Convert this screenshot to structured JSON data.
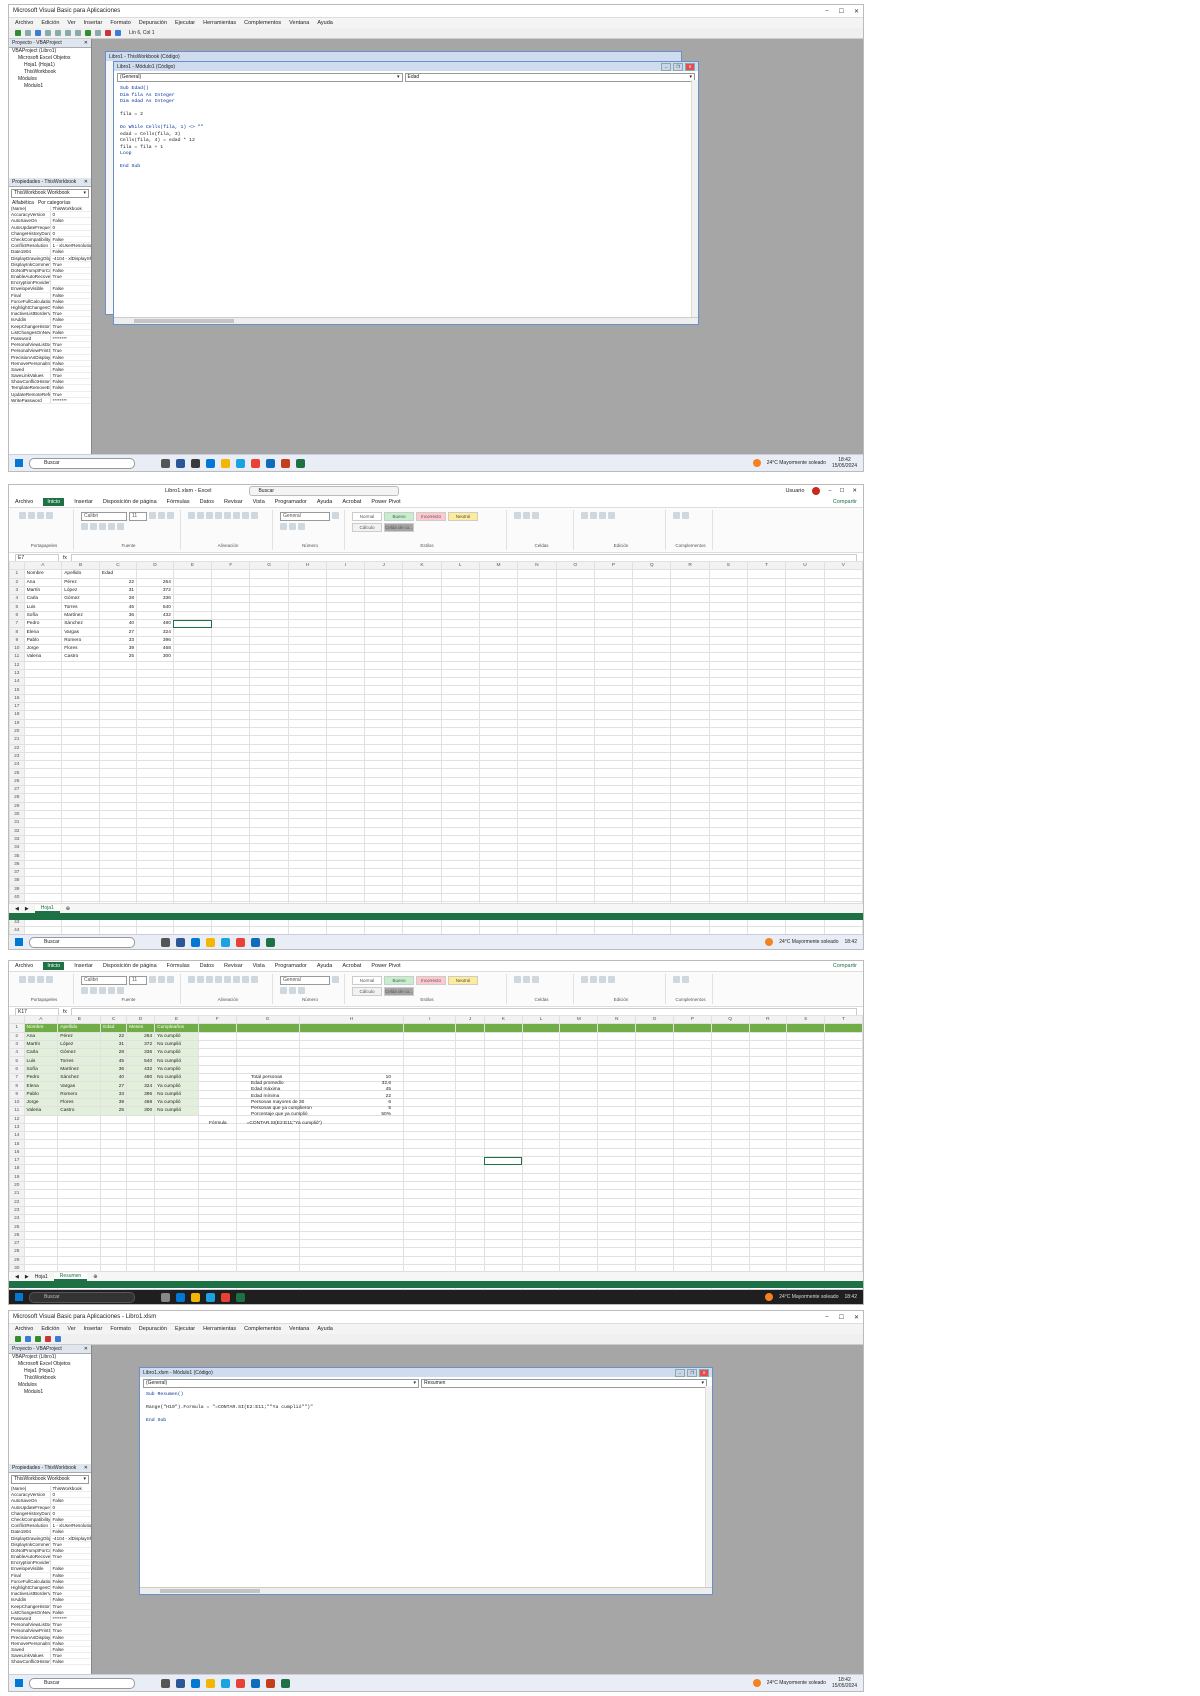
{
  "vba1": {
    "title": "Microsoft Visual Basic para Aplicaciones",
    "menu": [
      "Archivo",
      "Edición",
      "Ver",
      "Insertar",
      "Formato",
      "Depuración",
      "Ejecutar",
      "Herramientas",
      "Complementos",
      "Ventana",
      "Ayuda"
    ],
    "position": "Lín 6, Col 1",
    "project_title": "Proyecto - VBAProject",
    "tree": [
      "VBAProject (Libro1)",
      "Microsoft Excel Objetos",
      "Hoja1 (Hoja1)",
      "ThisWorkbook",
      "Módulos",
      "Módulo1"
    ],
    "props_title": "Propiedades - ThisWorkbook",
    "props_object": "ThisWorkbook Workbook",
    "props_tabs": [
      "Alfabética",
      "Por categorías"
    ],
    "props": [
      [
        "(Name)",
        "ThisWorkbook"
      ],
      [
        "AccuracyVersion",
        "0"
      ],
      [
        "AutoSaveOn",
        "False"
      ],
      [
        "AutoUpdateFrequency",
        "0"
      ],
      [
        "ChangeHistoryDuration",
        "0"
      ],
      [
        "CheckCompatibility",
        "False"
      ],
      [
        "ConflictResolution",
        "1 - xlUserResolution"
      ],
      [
        "Date1904",
        "False"
      ],
      [
        "DisplayDrawingObjects",
        "-4104 - xlDisplayShapes"
      ],
      [
        "DisplayInkComments",
        "True"
      ],
      [
        "DoNotPromptForConvert",
        "False"
      ],
      [
        "EnableAutoRecover",
        "True"
      ],
      [
        "EncryptionProvider",
        ""
      ],
      [
        "EnvelopeVisible",
        "False"
      ],
      [
        "Final",
        "False"
      ],
      [
        "ForceFullCalculation",
        "False"
      ],
      [
        "HighlightChangesOnScreen",
        "False"
      ],
      [
        "InactiveListBorderVisible",
        "True"
      ],
      [
        "IsAddin",
        "False"
      ],
      [
        "KeepChangeHistory",
        "True"
      ],
      [
        "ListChangesOnNewSheet",
        "False"
      ],
      [
        "Password",
        "********"
      ],
      [
        "PersonalViewListSettings",
        "True"
      ],
      [
        "PersonalViewPrintSettings",
        "True"
      ],
      [
        "PrecisionAsDisplayed",
        "False"
      ],
      [
        "RemovePersonalInformation",
        "False"
      ],
      [
        "Saved",
        "False"
      ],
      [
        "SaveLinkValues",
        "True"
      ],
      [
        "ShowConflictHistory",
        "False"
      ],
      [
        "TemplateRemoveExtData",
        "False"
      ],
      [
        "UpdateRemoteReferences",
        "True"
      ],
      [
        "WritePassword",
        "********"
      ]
    ],
    "codewin_back": "Libro1 - ThisWorkbook (Código)",
    "codewin_title": "Libro1 - Módulo1 (Código)",
    "combo_left": "(General)",
    "combo_right": "Edad",
    "code": [
      "Sub Edad()",
      "Dim fila As Integer",
      "Dim edad As Integer",
      "",
      "fila = 2",
      "",
      "Do While Cells(fila, 1) <> \"\"",
      "edad = Cells(fila, 3)",
      "Cells(fila, 4) = edad * 12",
      "fila = fila + 1",
      "Loop",
      "",
      "End Sub"
    ]
  },
  "excel1": {
    "title": "Libro1.xlsm - Excel",
    "search": "Buscar",
    "user": "Usuario",
    "tabs": [
      "Archivo",
      "Inicio",
      "Insertar",
      "Disposición de página",
      "Fórmulas",
      "Datos",
      "Revisar",
      "Vista",
      "Programador",
      "Ayuda",
      "Acrobat",
      "Power Pivot"
    ],
    "share": "Compartir",
    "groups": [
      "Portapapeles",
      "Fuente",
      "Alineación",
      "Número",
      "Estilos",
      "Celdas",
      "Edición",
      "Complementos"
    ],
    "font": "Calibri",
    "font_size": "11",
    "number_format": "General",
    "styles": [
      "Normal",
      "Bueno",
      "Incorrecto",
      "Neutral",
      "Cálculo",
      "Celda de co..."
    ],
    "namebox": "E7",
    "cols": [
      "A",
      "B",
      "C",
      "D",
      "E",
      "F",
      "G",
      "H",
      "I",
      "J",
      "K",
      "L",
      "M",
      "N",
      "O",
      "P",
      "Q",
      "R",
      "S",
      "T",
      "U",
      "V"
    ],
    "header": [
      "Nombre",
      "Apellido",
      "Edad",
      ""
    ],
    "rows": [
      [
        "Ana",
        "Pérez",
        "22",
        "264"
      ],
      [
        "Martín",
        "López",
        "31",
        "372"
      ],
      [
        "Carla",
        "Gómez",
        "28",
        "336"
      ],
      [
        "Luis",
        "Torres",
        "45",
        "540"
      ],
      [
        "Sofía",
        "Martínez",
        "36",
        "432"
      ],
      [
        "Pedro",
        "Sánchez",
        "40",
        "480"
      ],
      [
        "Elena",
        "Vargas",
        "27",
        "324"
      ],
      [
        "Pablo",
        "Romero",
        "33",
        "396"
      ],
      [
        "Jorge",
        "Flores",
        "39",
        "468"
      ],
      [
        "Valeria",
        "Castro",
        "25",
        "300"
      ]
    ],
    "sheet": "Hoja1"
  },
  "excel2": {
    "namebox": "K17",
    "headers": [
      "Nombre",
      "Apellido",
      "Edad",
      "Meses",
      "Cumpleaños"
    ],
    "rows": [
      [
        "Ana",
        "Pérez",
        "22",
        "264",
        "Ya cumplió"
      ],
      [
        "Martín",
        "López",
        "31",
        "372",
        "No cumplió"
      ],
      [
        "Carla",
        "Gómez",
        "28",
        "336",
        "Ya cumplió"
      ],
      [
        "Luis",
        "Torres",
        "45",
        "540",
        "No cumplió"
      ],
      [
        "Sofía",
        "Martínez",
        "36",
        "432",
        "Ya cumplió"
      ],
      [
        "Pedro",
        "Sánchez",
        "40",
        "480",
        "No cumplió"
      ],
      [
        "Elena",
        "Vargas",
        "27",
        "324",
        "Ya cumplió"
      ],
      [
        "Pablo",
        "Romero",
        "33",
        "396",
        "No cumplió"
      ],
      [
        "Jorge",
        "Flores",
        "39",
        "468",
        "Ya cumplió"
      ],
      [
        "Valeria",
        "Castro",
        "25",
        "300",
        "No cumplió"
      ]
    ],
    "summary": [
      [
        "Total personas",
        "10"
      ],
      [
        "Edad promedio",
        "32,6"
      ],
      [
        "Edad máxima",
        "45"
      ],
      [
        "Edad mínima",
        "22"
      ],
      [
        "Personas mayores de 30",
        "6"
      ],
      [
        "Personas que ya cumplieron",
        "5"
      ],
      [
        "Porcentaje que ya cumplió",
        "50%"
      ]
    ],
    "formula_label": "Fórmula",
    "formula_value": "=CONTAR.SI(E2:E11;\"Ya cumplió\")",
    "sheets": [
      "Hoja1",
      "Resumen"
    ]
  },
  "vba2": {
    "title": "Microsoft Visual Basic para Aplicaciones - Libro1.xlsm",
    "codewin_title": "Libro1.xlsm - Módulo1 (Código)",
    "combo_left": "(General)",
    "combo_right": "Resumen",
    "code": [
      "Sub Resumen()",
      "",
      "Range(\"H10\").Formula = \"=CONTAR.SI(E2:E11;\"\"Ya cumplió\"\")\"",
      "",
      "End Sub"
    ]
  },
  "taskbar": {
    "search": "Buscar",
    "weather": "24°C  Mayormente soleado",
    "time": "18:42",
    "date": "15/05/2024"
  }
}
